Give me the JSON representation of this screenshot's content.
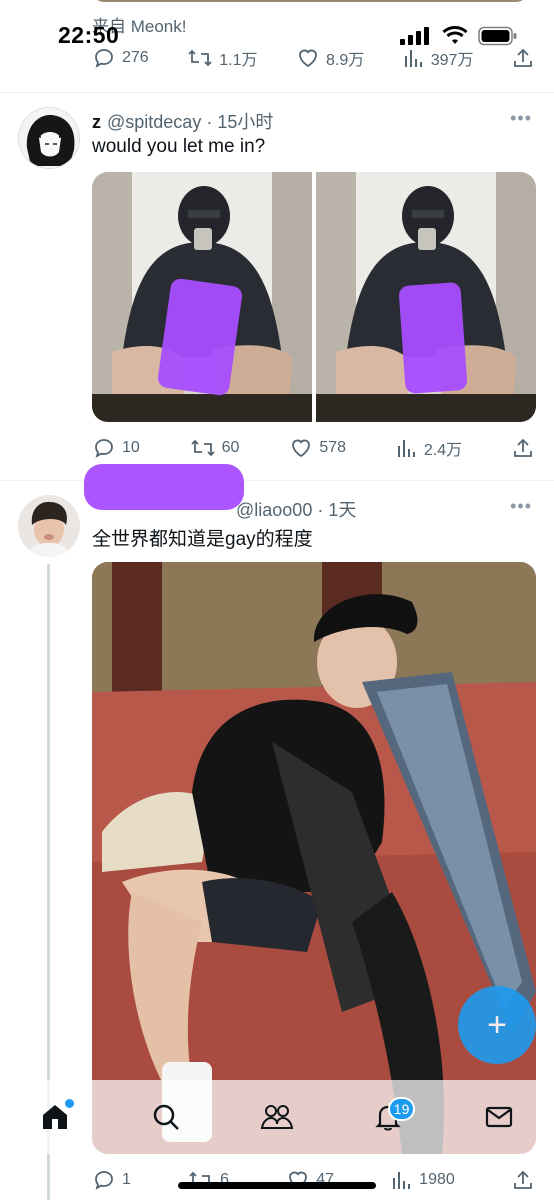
{
  "status_bar": {
    "time": "22:50"
  },
  "top_tweet": {
    "from_text": "来自 Meonk!",
    "replies": "276",
    "retweets": "1.1万",
    "likes": "8.9万",
    "views": "397万"
  },
  "tweet1": {
    "name": "z",
    "handle": "@spitdecay",
    "time": "15小时",
    "text": "would you let me in?",
    "replies": "10",
    "retweets": "60",
    "likes": "578",
    "views": "2.4万"
  },
  "tweet2": {
    "handle": "liaoo00",
    "time": "1天",
    "text": "全世界都知道是gay的程度",
    "replies": "1",
    "retweets": "6",
    "likes": "47",
    "views": "1980"
  },
  "tabbar": {
    "notifications_badge": "19"
  },
  "icons": [
    "signal-icon",
    "wifi-icon",
    "battery-icon",
    "reply-icon",
    "retweet-icon",
    "like-icon",
    "views-icon",
    "share-icon",
    "more-icon",
    "home-icon",
    "search-icon",
    "communities-icon",
    "notifications-icon",
    "messages-icon",
    "compose-icon"
  ],
  "colors": {
    "accent": "#1d9bf0",
    "text_primary": "#0f1419",
    "text_secondary": "#536471",
    "censor_purple": "#a64dff"
  }
}
